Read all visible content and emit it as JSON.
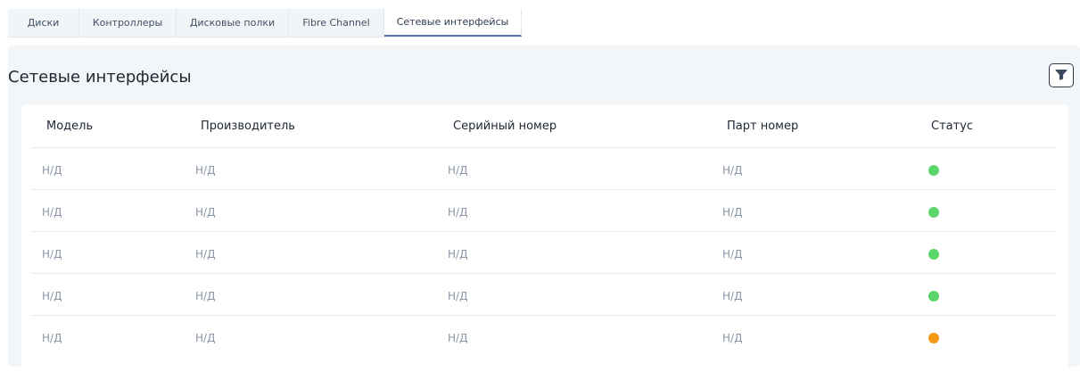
{
  "tabs": [
    {
      "label": "Диски"
    },
    {
      "label": "Контроллеры"
    },
    {
      "label": "Дисковые полки"
    },
    {
      "label": "Fibre Channel"
    },
    {
      "label": "Сетевые интерфейсы",
      "active": true
    }
  ],
  "panel": {
    "title": "Сетевые интерфейсы",
    "filter_icon": "filter-icon"
  },
  "table": {
    "columns": [
      "Модель",
      "Производитель",
      "Серийный номер",
      "Парт номер",
      "Статус"
    ],
    "rows": [
      {
        "model": "Н/Д",
        "vendor": "Н/Д",
        "serial": "Н/Д",
        "part": "Н/Д",
        "status": "ok"
      },
      {
        "model": "Н/Д",
        "vendor": "Н/Д",
        "serial": "Н/Д",
        "part": "Н/Д",
        "status": "ok"
      },
      {
        "model": "Н/Д",
        "vendor": "Н/Д",
        "serial": "Н/Д",
        "part": "Н/Д",
        "status": "ok"
      },
      {
        "model": "Н/Д",
        "vendor": "Н/Д",
        "serial": "Н/Д",
        "part": "Н/Д",
        "status": "ok"
      },
      {
        "model": "Н/Д",
        "vendor": "Н/Д",
        "serial": "Н/Д",
        "part": "Н/Д",
        "status": "warning"
      }
    ]
  },
  "colors": {
    "status_ok": "#5ad66a",
    "status_warning": "#f39a14",
    "tab_active_underline": "#5a6fa8"
  }
}
